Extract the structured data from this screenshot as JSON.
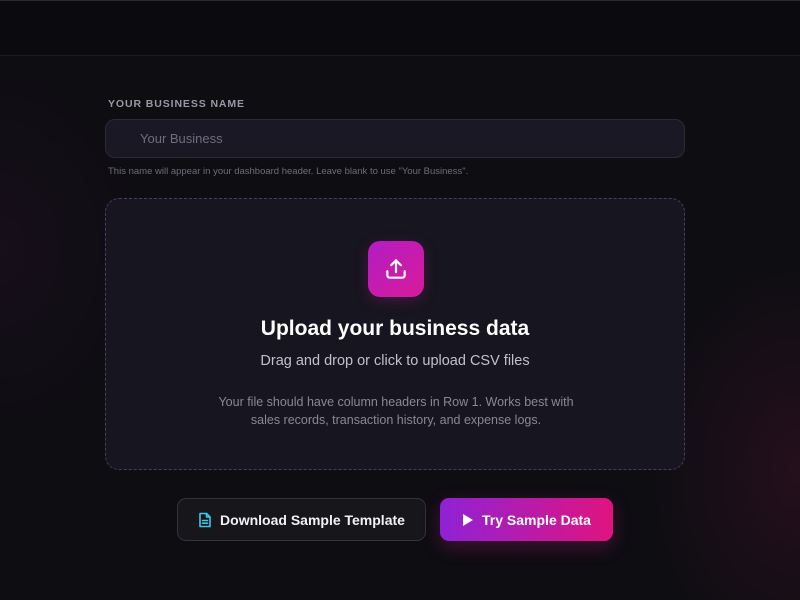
{
  "business_name": {
    "label": "Your Business Name",
    "placeholder": "Your Business",
    "value": "",
    "helper": "This name will appear in your dashboard header. Leave blank to use \"Your Business\"."
  },
  "upload": {
    "icon": "upload-icon",
    "title": "Upload your business data",
    "subtitle": "Drag and drop or click to upload CSV files",
    "hint": "Your file should have column headers in Row 1. Works best with sales records, transaction history, and expense logs."
  },
  "actions": {
    "template_label": "Download Sample Template",
    "template_icon": "document-icon",
    "sample_label": "Try Sample Data",
    "sample_icon": "play-icon"
  },
  "colors": {
    "background": "#0e0d12",
    "accent_start": "#8f22d6",
    "accent_end": "#e0147e",
    "template_icon": "#3ec7e8"
  }
}
